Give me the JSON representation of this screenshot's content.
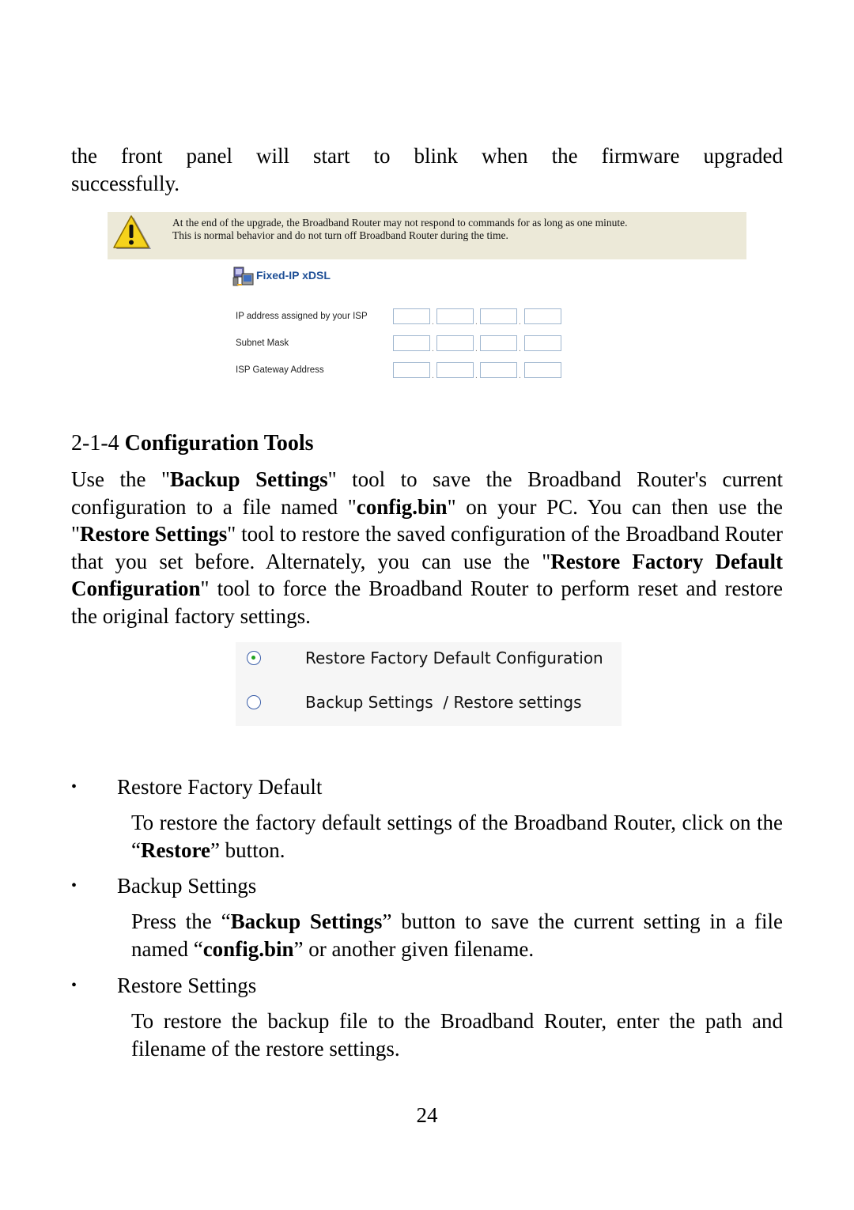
{
  "intro": {
    "line1": "the front panel will start to blink when the firmware upgraded",
    "line2": "successfully."
  },
  "warning_banner": {
    "icon": "warning-icon",
    "line1": "At the end of the upgrade, the Broadband Router may not respond to commands for as long as one minute.",
    "line2": "This is normal behavior and do not turn off Broadband Router during the time."
  },
  "fixed_ip": {
    "icon": "network-computer-icon",
    "title": "Fixed-IP xDSL",
    "rows": [
      {
        "label": "IP address assigned by your ISP",
        "octets": [
          "",
          "",
          "",
          ""
        ]
      },
      {
        "label": "Subnet Mask",
        "octets": [
          "",
          "",
          "",
          ""
        ]
      },
      {
        "label": "ISP Gateway Address",
        "octets": [
          "",
          "",
          "",
          ""
        ]
      }
    ]
  },
  "section": {
    "number": "2-1-4",
    "title": "Configuration Tools",
    "paragraph": [
      {
        "t": "Use the \"",
        "b": false
      },
      {
        "t": "Backup Settings",
        "b": true
      },
      {
        "t": "\" tool to save the Broadband Router's current configuration to a file named \"",
        "b": false
      },
      {
        "t": "config.bin",
        "b": true
      },
      {
        "t": "\" on your PC. You can then use the \"",
        "b": false
      },
      {
        "t": "Restore Settings",
        "b": true
      },
      {
        "t": "\" tool to restore the saved configuration of the Broadband Router that you set before. Alternately, you can use the \"",
        "b": false
      },
      {
        "t": "Restore Factory Default Configuration",
        "b": true
      },
      {
        "t": "\" tool to force the Broadband Router to perform reset and restore the original factory settings.",
        "b": false
      }
    ]
  },
  "radio_options": [
    {
      "label": "Restore Factory Default Configuration",
      "checked": true
    },
    {
      "label": "Backup Settings  / Restore settings",
      "checked": false
    }
  ],
  "bullets": [
    {
      "title": "Restore Factory Default",
      "desc": [
        {
          "t": "To restore the factory default settings of the Broadband Router, click on the “",
          "b": false
        },
        {
          "t": "Restore",
          "b": true
        },
        {
          "t": "” button.",
          "b": false
        }
      ]
    },
    {
      "title": "Backup Settings",
      "desc": [
        {
          "t": "Press the “",
          "b": false
        },
        {
          "t": "Backup Settings",
          "b": true
        },
        {
          "t": "” button to save the current setting in a file named “",
          "b": false
        },
        {
          "t": "config.bin",
          "b": true
        },
        {
          "t": "” or another given filename.",
          "b": false
        }
      ]
    },
    {
      "title": "Restore Settings",
      "desc": [
        {
          "t": "To restore the backup file to the Broadband Router, enter the path and filename of the restore settings.",
          "b": false
        }
      ]
    }
  ],
  "bullet_glyph": "•",
  "page_number": "24"
}
